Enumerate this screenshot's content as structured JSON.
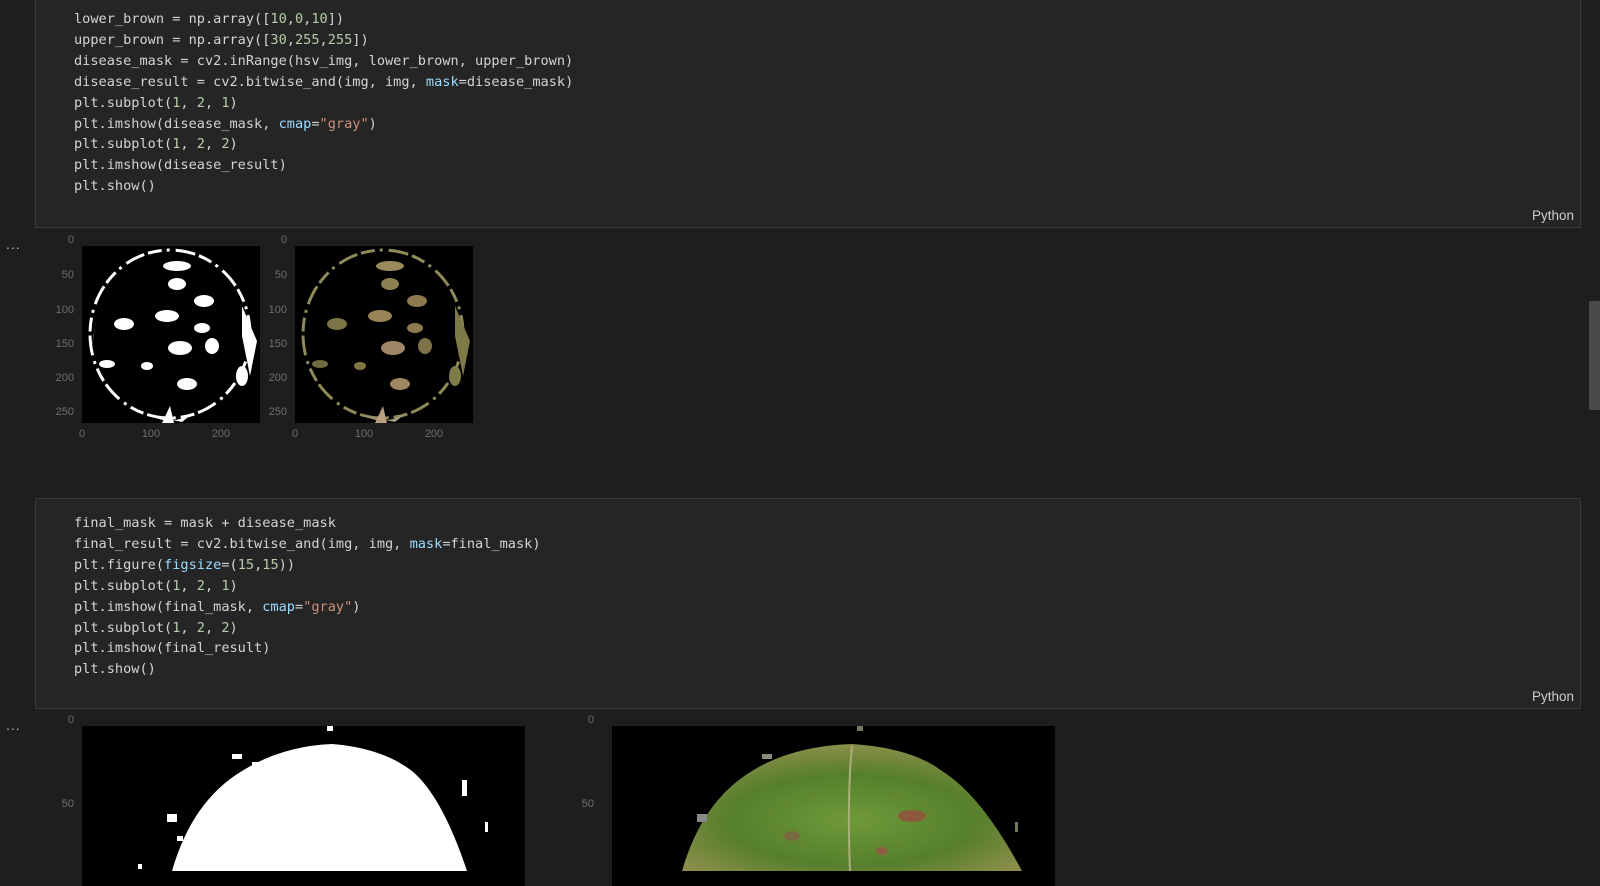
{
  "cells": [
    {
      "lines": [
        [
          {
            "t": "lower_brown = np.array(["
          },
          {
            "t": "10",
            "c": "num"
          },
          {
            "t": ","
          },
          {
            "t": "0",
            "c": "num"
          },
          {
            "t": ","
          },
          {
            "t": "10",
            "c": "num"
          },
          {
            "t": "])"
          }
        ],
        [
          {
            "t": "upper_brown = np.array(["
          },
          {
            "t": "30",
            "c": "num"
          },
          {
            "t": ","
          },
          {
            "t": "255",
            "c": "num"
          },
          {
            "t": ","
          },
          {
            "t": "255",
            "c": "num"
          },
          {
            "t": "])"
          }
        ],
        [
          {
            "t": "disease_mask = cv2.inRange(hsv_img, lower_brown, upper_brown)"
          }
        ],
        [
          {
            "t": "disease_result = cv2.bitwise_and(img, img, "
          },
          {
            "t": "mask",
            "c": "kw"
          },
          {
            "t": "=disease_mask)"
          }
        ],
        [
          {
            "t": "plt.subplot("
          },
          {
            "t": "1",
            "c": "num"
          },
          {
            "t": ", "
          },
          {
            "t": "2",
            "c": "num"
          },
          {
            "t": ", "
          },
          {
            "t": "1",
            "c": "num"
          },
          {
            "t": ")"
          }
        ],
        [
          {
            "t": "plt.imshow(disease_mask, "
          },
          {
            "t": "cmap",
            "c": "kw"
          },
          {
            "t": "="
          },
          {
            "t": "\"gray\"",
            "c": "str"
          },
          {
            "t": ")"
          }
        ],
        [
          {
            "t": "plt.subplot("
          },
          {
            "t": "1",
            "c": "num"
          },
          {
            "t": ", "
          },
          {
            "t": "2",
            "c": "num"
          },
          {
            "t": ", "
          },
          {
            "t": "2",
            "c": "num"
          },
          {
            "t": ")"
          }
        ],
        [
          {
            "t": "plt.imshow(disease_result)"
          }
        ],
        [
          {
            "t": "plt.show()"
          }
        ]
      ],
      "language": "Python"
    },
    {
      "lines": [
        [
          {
            "t": "final_mask = mask + disease_mask"
          }
        ],
        [
          {
            "t": "final_result = cv2.bitwise_and(img, img, "
          },
          {
            "t": "mask",
            "c": "kw"
          },
          {
            "t": "=final_mask)"
          }
        ],
        [
          {
            "t": "plt.figure("
          },
          {
            "t": "figsize",
            "c": "kw"
          },
          {
            "t": "=("
          },
          {
            "t": "15",
            "c": "num"
          },
          {
            "t": ","
          },
          {
            "t": "15",
            "c": "num"
          },
          {
            "t": "))"
          }
        ],
        [
          {
            "t": "plt.subplot("
          },
          {
            "t": "1",
            "c": "num"
          },
          {
            "t": ", "
          },
          {
            "t": "2",
            "c": "num"
          },
          {
            "t": ", "
          },
          {
            "t": "1",
            "c": "num"
          },
          {
            "t": ")"
          }
        ],
        [
          {
            "t": "plt.imshow(final_mask, "
          },
          {
            "t": "cmap",
            "c": "kw"
          },
          {
            "t": "="
          },
          {
            "t": "\"gray\"",
            "c": "str"
          },
          {
            "t": ")"
          }
        ],
        [
          {
            "t": "plt.subplot("
          },
          {
            "t": "1",
            "c": "num"
          },
          {
            "t": ", "
          },
          {
            "t": "2",
            "c": "num"
          },
          {
            "t": ", "
          },
          {
            "t": "2",
            "c": "num"
          },
          {
            "t": ")"
          }
        ],
        [
          {
            "t": "plt.imshow(final_result)"
          }
        ],
        [
          {
            "t": "plt.show()"
          }
        ]
      ],
      "language": "Python"
    }
  ],
  "output_menu_label": "...",
  "outputs": {
    "small_plots": {
      "yticks": [
        "0",
        "50",
        "100",
        "150",
        "200",
        "250"
      ],
      "xticks": [
        "0",
        "100",
        "200"
      ]
    },
    "large_plots": {
      "yticks": [
        "0",
        "50"
      ]
    }
  },
  "colors": {
    "keyword": "#9cdcfe",
    "string": "#ce9178",
    "number": "#b5cea8",
    "background": "#1e1e1e",
    "cell_bg": "#252526"
  }
}
